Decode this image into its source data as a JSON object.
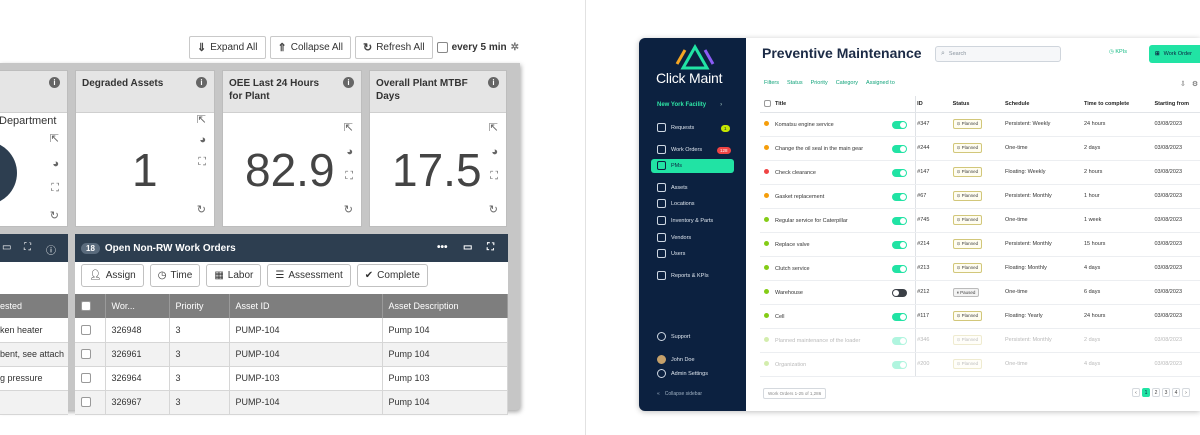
{
  "left": {
    "toolbar": {
      "expand_all": "Expand All",
      "collapse_all": "Collapse All",
      "refresh_all": "Refresh All",
      "refresh_interval": "every 5 min"
    },
    "cards": [
      {
        "title": "Department",
        "partial": true
      },
      {
        "title": "Degraded Assets",
        "value": "1"
      },
      {
        "title": "OEE Last 24 Hours for Plant",
        "value": "82.9"
      },
      {
        "title": "Overall Plant MTBF Days",
        "value": "17.5"
      }
    ],
    "work_orders": {
      "count": "18",
      "title": "Open Non-RW Work Orders",
      "buttons": [
        "Assign",
        "Time",
        "Labor",
        "Assessment",
        "Complete"
      ],
      "columns": [
        "Wor...",
        "Priority",
        "Asset ID",
        "Asset Description"
      ],
      "rows": [
        {
          "wo": "326948",
          "priority": "3",
          "asset_id": "PUMP-104",
          "desc": "Pump 104"
        },
        {
          "wo": "326961",
          "priority": "3",
          "asset_id": "PUMP-104",
          "desc": "Pump 104"
        },
        {
          "wo": "326964",
          "priority": "3",
          "asset_id": "PUMP-103",
          "desc": "Pump 103"
        },
        {
          "wo": "326967",
          "priority": "3",
          "asset_id": "PUMP-104",
          "desc": "Pump 104"
        }
      ]
    },
    "left_panel": {
      "column": "ested",
      "rows": [
        "ken heater",
        "bent, see attach",
        "g pressure",
        ""
      ]
    }
  },
  "right": {
    "brand": "Click Maint",
    "facility": "New York Facility",
    "nav": [
      {
        "label": "Requests",
        "badge": "1"
      },
      {
        "label": "Work Orders",
        "badge": "128"
      },
      {
        "label": "PMs",
        "active": true
      },
      {
        "label": "Assets"
      },
      {
        "label": "Locations"
      },
      {
        "label": "Inventory & Parts"
      },
      {
        "label": "Vendors"
      },
      {
        "label": "Users"
      },
      {
        "label": "Reports & KPIs"
      }
    ],
    "bottom_nav": [
      "Support",
      "John Doe",
      "Admin Settings",
      "Collapse sidebar"
    ],
    "title": "Preventive Maintenance",
    "search_placeholder": "Search",
    "kpis": "KPIs",
    "new_wo": "Work Order",
    "filters": [
      "Filters",
      "Status",
      "Priority",
      "Category",
      "Assigned to"
    ],
    "columns": [
      "Title",
      "ID",
      "Status",
      "Schedule",
      "Time to complete",
      "Starting from"
    ],
    "rows": [
      {
        "title": "Komatsu engine service",
        "id": "#347",
        "status": "Planned",
        "schedule": "Persistent: Weekly",
        "ttc": "24 hours",
        "start": "03/08/2023",
        "on": true,
        "color": "#f59e0b"
      },
      {
        "title": "Change the oil seal in the main gear",
        "id": "#244",
        "status": "Planned",
        "schedule": "One-time",
        "ttc": "2 days",
        "start": "03/08/2023",
        "on": true,
        "color": "#f59e0b"
      },
      {
        "title": "Check clearance",
        "id": "#147",
        "status": "Planned",
        "schedule": "Floating: Weekly",
        "ttc": "2 hours",
        "start": "03/08/2023",
        "on": true,
        "color": "#ef4444"
      },
      {
        "title": "Gasket replacement",
        "id": "#67",
        "status": "Planned",
        "schedule": "Persistent: Monthly",
        "ttc": "1 hour",
        "start": "03/08/2023",
        "on": true,
        "color": "#f59e0b"
      },
      {
        "title": "Regular service for Caterpillar",
        "id": "#745",
        "status": "Planned",
        "schedule": "One-time",
        "ttc": "1 week",
        "start": "03/08/2023",
        "on": true,
        "color": "#84cc16"
      },
      {
        "title": "Replace valve",
        "id": "#214",
        "status": "Planned",
        "schedule": "Persistent: Monthly",
        "ttc": "15 hours",
        "start": "03/08/2023",
        "on": true,
        "color": "#84cc16"
      },
      {
        "title": "Clutch service",
        "id": "#213",
        "status": "Planned",
        "schedule": "Floating: Monthly",
        "ttc": "4 days",
        "start": "03/08/2023",
        "on": true,
        "color": "#84cc16"
      },
      {
        "title": "Warehouse",
        "id": "#212",
        "status": "Paused",
        "schedule": "One-time",
        "ttc": "6 days",
        "start": "03/08/2023",
        "on": false,
        "color": "#84cc16"
      },
      {
        "title": "Cell",
        "id": "#117",
        "status": "Planned",
        "schedule": "Floating: Yearly",
        "ttc": "24 hours",
        "start": "03/08/2023",
        "on": true,
        "color": "#84cc16"
      },
      {
        "title": "Planned maintenance of the loader",
        "id": "#346",
        "status": "Planned",
        "schedule": "Persistent: Monthly",
        "ttc": "2 days",
        "start": "03/08/2023",
        "on": true,
        "color": "#84cc16",
        "fade": true
      },
      {
        "title": "Organization",
        "id": "#200",
        "status": "Planned",
        "schedule": "One-time",
        "ttc": "4 days",
        "start": "03/08/2023",
        "on": true,
        "color": "#84cc16",
        "fade": true
      }
    ],
    "footer_count": "Work Orders 1-25 of 1,286",
    "pages": [
      "‹",
      "1",
      "2",
      "3",
      "4",
      "›"
    ]
  }
}
